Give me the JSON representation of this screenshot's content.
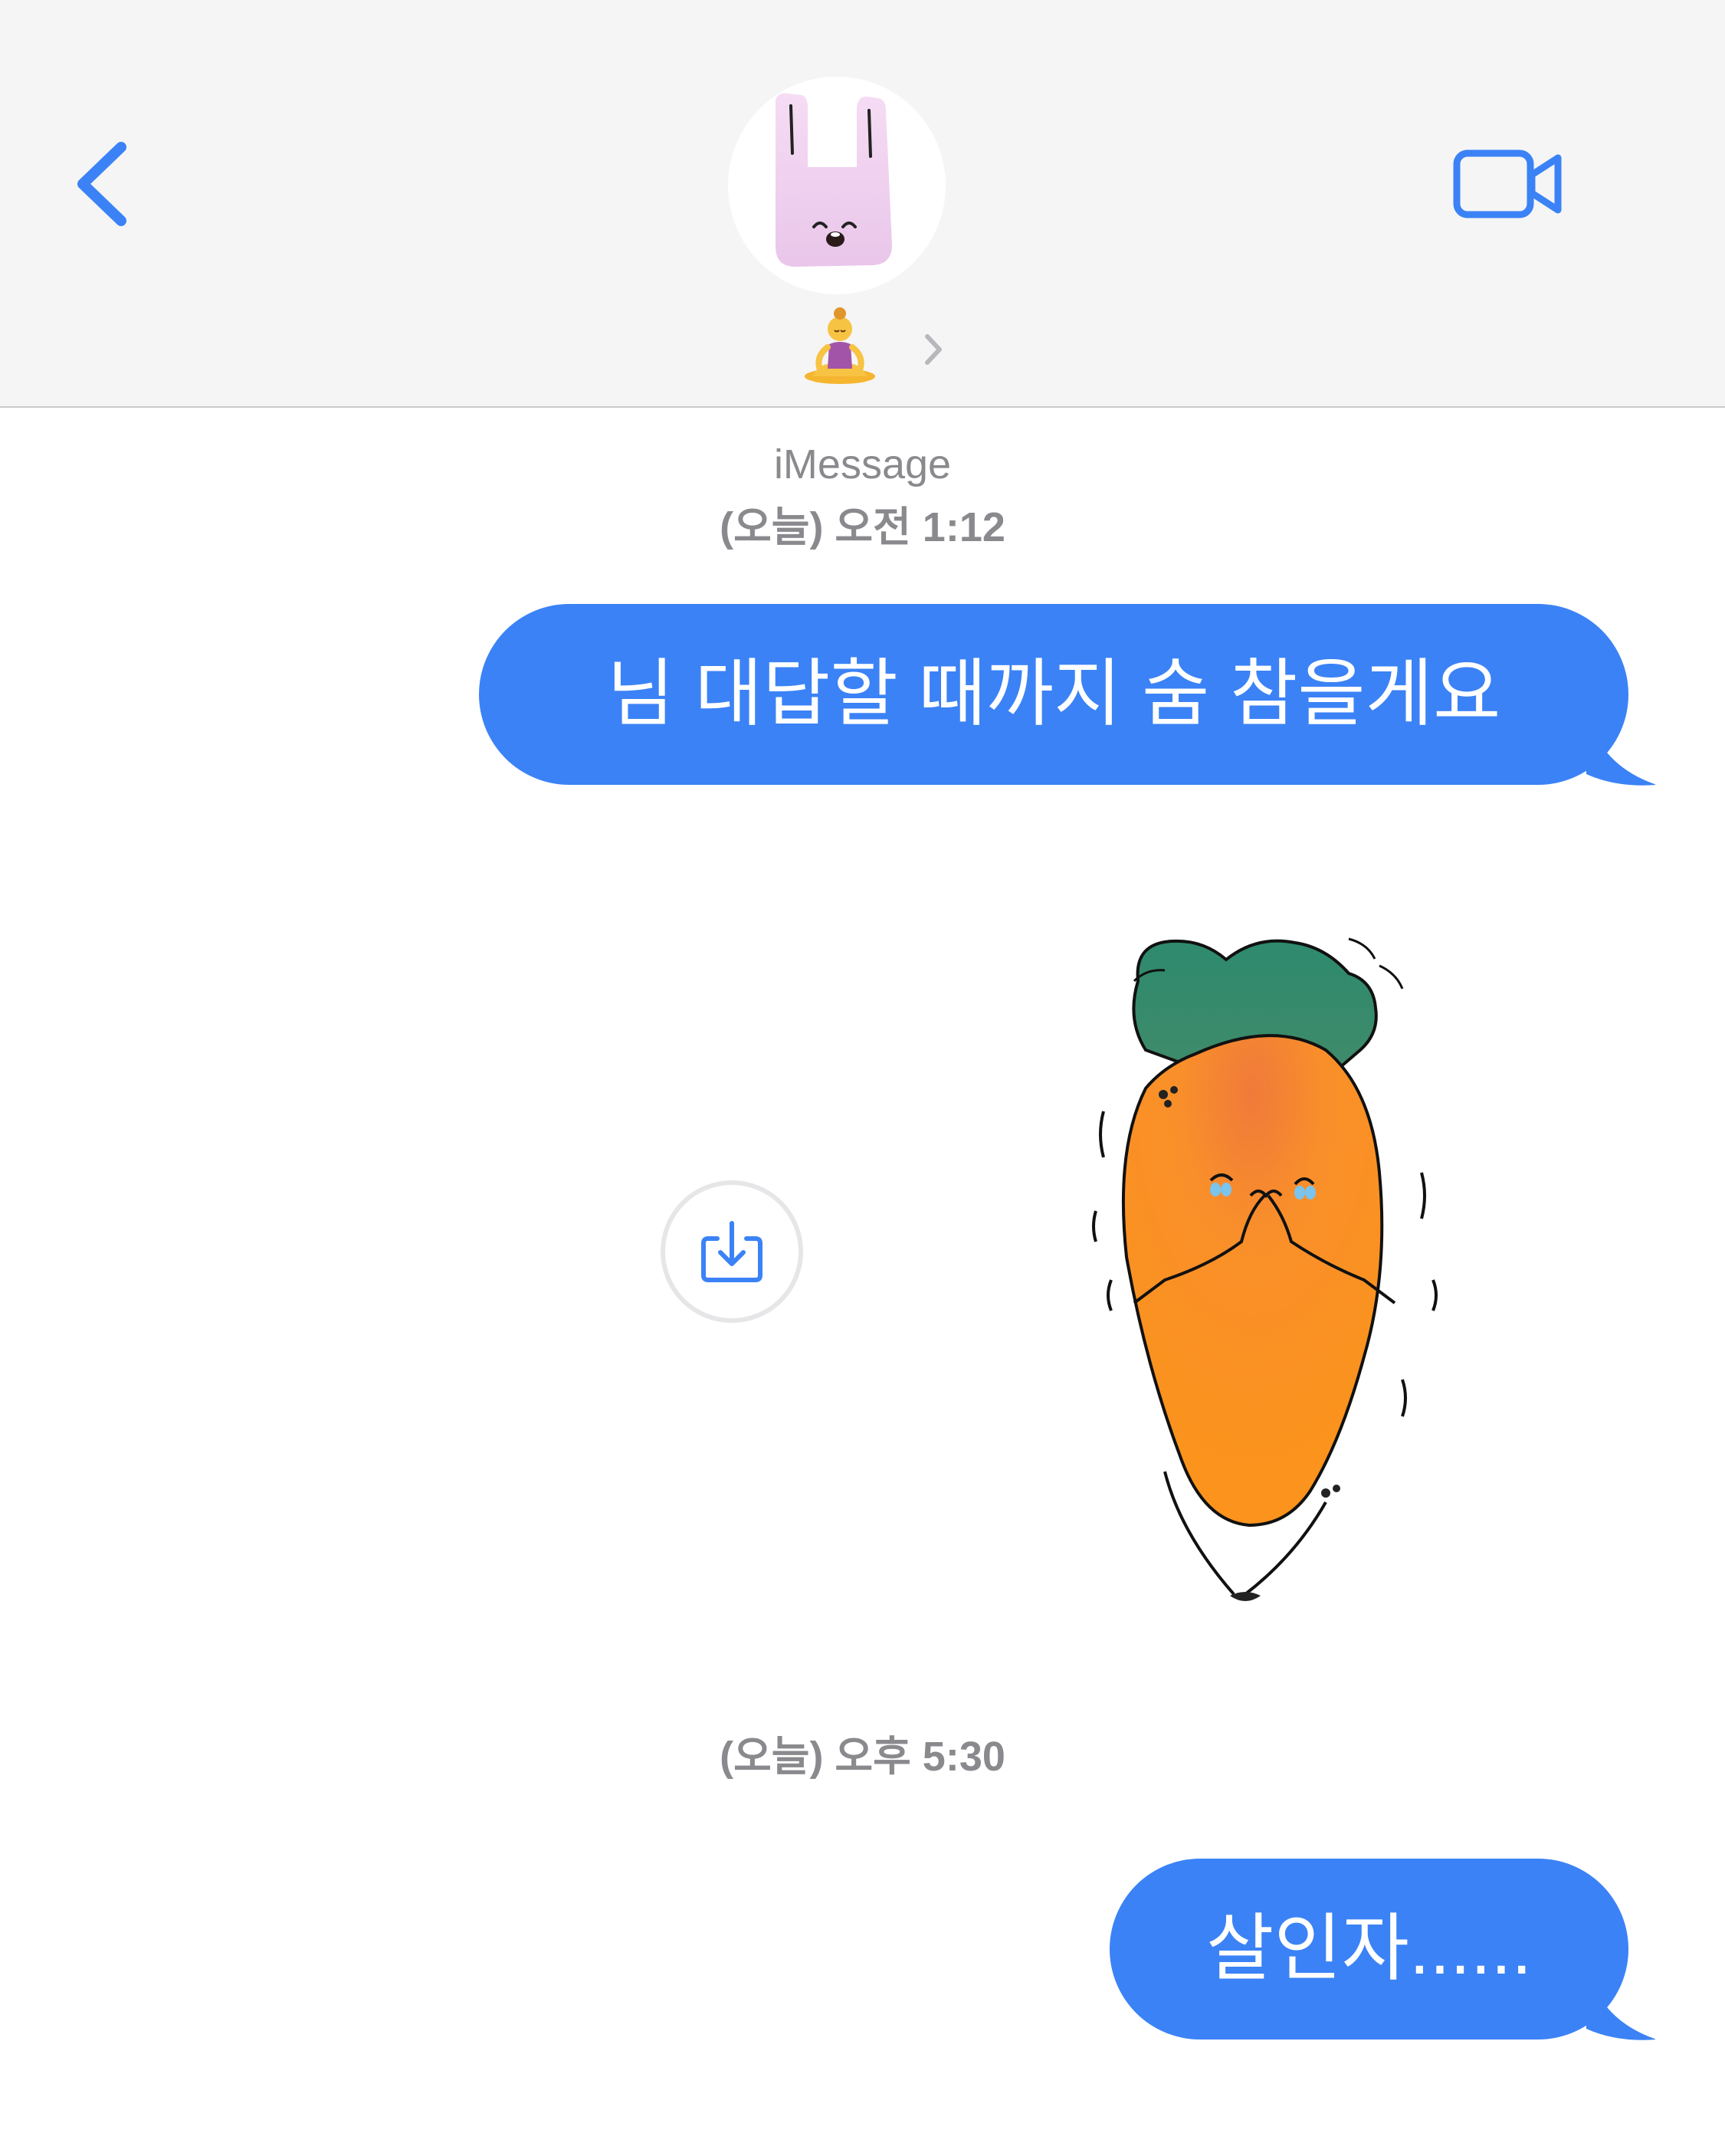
{
  "header": {
    "back_icon": "chevron-left-icon",
    "video_icon": "video-camera-icon",
    "contact_avatar": "pink-bunny-bag-avatar",
    "contact_name_emoji": "🧘‍♀️",
    "chevron_icon": "chevron-right-icon"
  },
  "conversation": {
    "service_label": "iMessage",
    "timestamp_1": "(오늘) 오전 1:12",
    "timestamp_2": "(오늘) 오후 5:30",
    "messages": [
      {
        "direction": "outgoing",
        "text": "님 대답할 때까지 숨 참을게요"
      },
      {
        "direction": "outgoing",
        "type": "sticker",
        "sticker": "crying-carrot-sticker"
      },
      {
        "direction": "outgoing",
        "text": "살인자......"
      }
    ],
    "save_icon": "download-tray-icon"
  },
  "colors": {
    "accent": "#3b82f6",
    "header_bg": "#f5f5f5",
    "meta_text": "#8a8a8e"
  }
}
